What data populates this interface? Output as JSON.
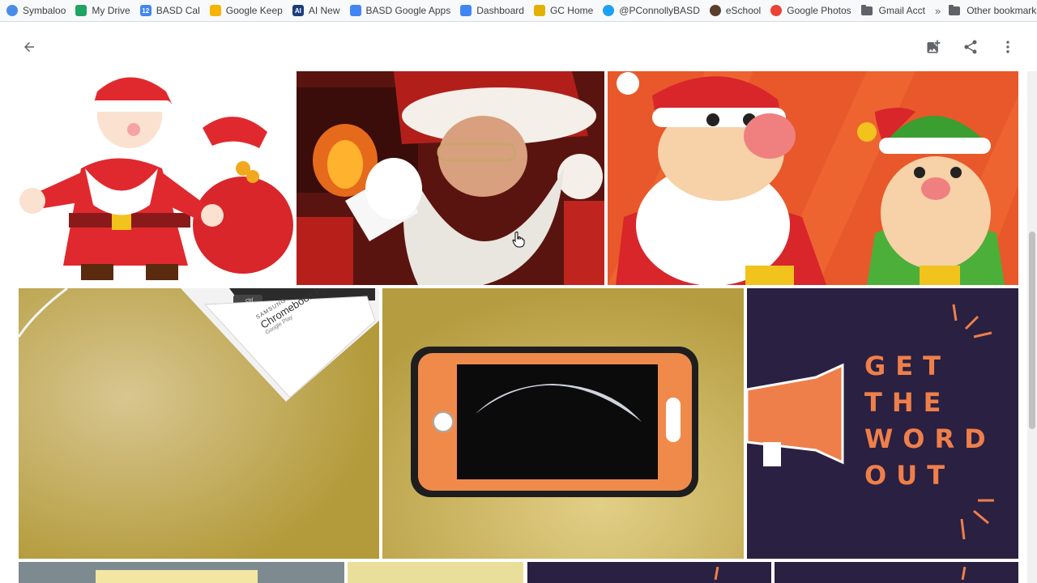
{
  "bookmarks": [
    {
      "label": "Symbaloo",
      "icon": "symbaloo-icon",
      "color": "#4a8de8"
    },
    {
      "label": "My Drive",
      "icon": "google-drive-icon",
      "color": "#1fa463"
    },
    {
      "label": "BASD Cal",
      "icon": "calendar-icon",
      "color": "#4285f4",
      "glyph": "12"
    },
    {
      "label": "Google Keep",
      "icon": "keep-icon",
      "color": "#f6b400"
    },
    {
      "label": "AI New",
      "icon": "ai-icon",
      "color": "#1a3d7c",
      "glyph": "AI"
    },
    {
      "label": "BASD Google Apps",
      "icon": "sites-icon",
      "color": "#4285f4"
    },
    {
      "label": "Dashboard",
      "icon": "classroom-dashboard-icon",
      "color": "#4285f4"
    },
    {
      "label": "GC Home",
      "icon": "classroom-icon",
      "color": "#e2b100"
    },
    {
      "label": "@PConnollyBASD",
      "icon": "twitter-icon",
      "color": "#1da1f2"
    },
    {
      "label": "eSchool",
      "icon": "eschool-icon",
      "color": "#5a3e2b"
    },
    {
      "label": "Google Photos",
      "icon": "photos-icon",
      "color": "#ea4335"
    },
    {
      "label": "Gmail Acct",
      "icon": "folder-icon",
      "color": "#5f6368"
    }
  ],
  "bookmarks_overflow": "»",
  "other_bookmarks": "Other bookmarks",
  "header": {
    "back_icon": "arrow-back-icon",
    "actions": [
      "add-photo-icon",
      "share-icon",
      "more-vert-icon"
    ]
  },
  "photos": [
    {
      "id": "santa-cartoon",
      "alt": "Cartoon Santa with gift sack"
    },
    {
      "id": "santa-photo",
      "alt": "Santa with glasses"
    },
    {
      "id": "santa-elf-cartoon",
      "alt": "Cartoon Santa and elf"
    },
    {
      "id": "chromebook-box",
      "alt": "Chromebook box on table"
    },
    {
      "id": "phone-moon",
      "alt": "Phone showing moon"
    },
    {
      "id": "get-the-word-out",
      "alt": "Get the word out megaphone"
    },
    {
      "id": "row3-1"
    },
    {
      "id": "row3-2"
    },
    {
      "id": "row3-3"
    },
    {
      "id": "row3-4"
    }
  ],
  "poster": {
    "lines": [
      "GET",
      "THE",
      "WORD",
      "OUT"
    ],
    "color": "#ef7f4a",
    "bg": "#2a2041"
  },
  "chromebook_box_text": {
    "brand": "SAMSUNG",
    "model": "Chromebook Plus",
    "store": "Google Play",
    "key": "ctrl"
  }
}
